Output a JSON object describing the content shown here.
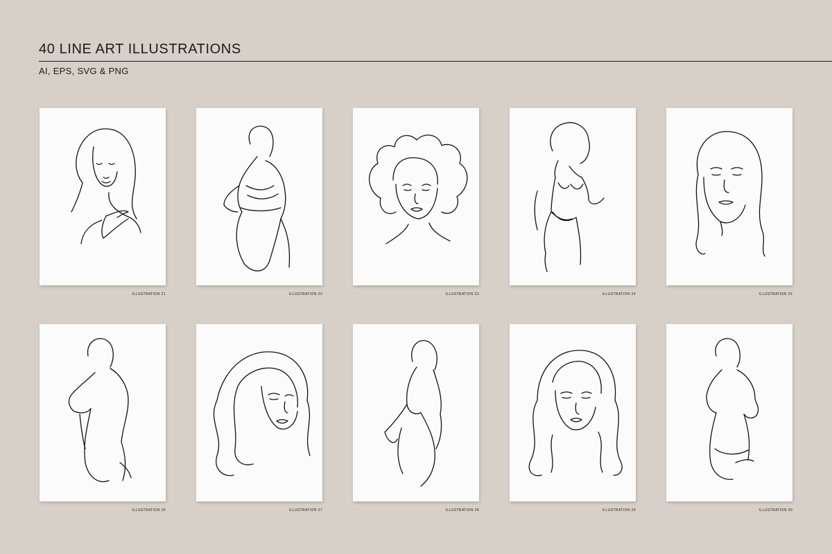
{
  "header": {
    "title": "40 LINE ART ILLUSTRATIONS",
    "subtitle": "AI, EPS, SVG & PNG"
  },
  "illustrations": [
    {
      "caption": "ILLUSTRATION 21",
      "subject": "woman-portrait-hand-on-shoulder"
    },
    {
      "caption": "ILLUSTRATION 22",
      "subject": "woman-back-bikini"
    },
    {
      "caption": "ILLUSTRATION 23",
      "subject": "woman-afro-portrait"
    },
    {
      "caption": "ILLUSTRATION 24",
      "subject": "woman-afro-bikini-standing"
    },
    {
      "caption": "ILLUSTRATION 25",
      "subject": "woman-long-hair-portrait"
    },
    {
      "caption": "ILLUSTRATION 26",
      "subject": "woman-back-hand-on-hip"
    },
    {
      "caption": "ILLUSTRATION 27",
      "subject": "woman-wavy-hair-portrait"
    },
    {
      "caption": "ILLUSTRATION 28",
      "subject": "woman-side-profile-body"
    },
    {
      "caption": "ILLUSTRATION 29",
      "subject": "woman-long-wavy-hair-portrait"
    },
    {
      "caption": "ILLUSTRATION 30",
      "subject": "woman-back-bikini-bottom"
    }
  ]
}
